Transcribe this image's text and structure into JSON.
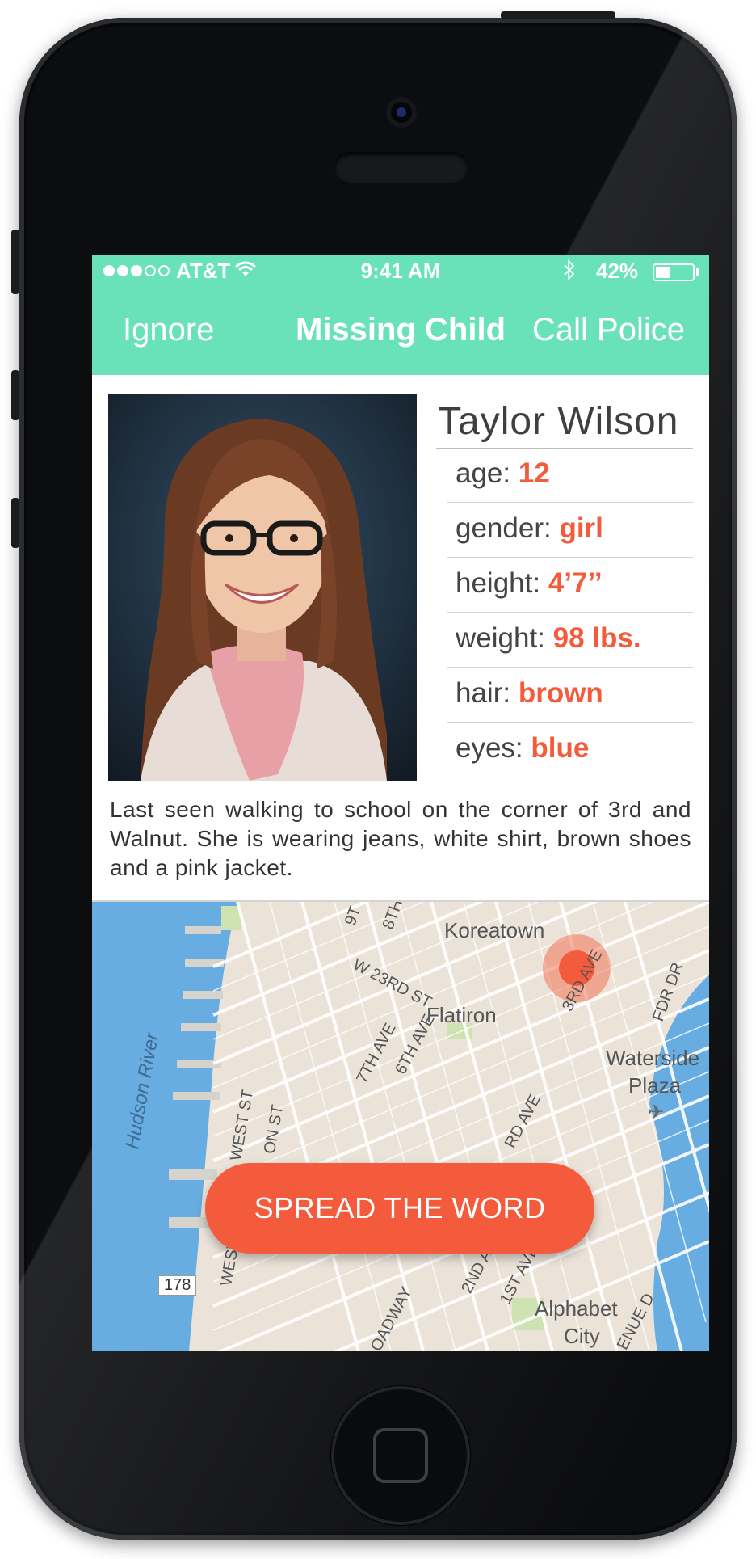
{
  "status_bar": {
    "carrier": "AT&T",
    "time": "9:41 AM",
    "battery_percent": "42%",
    "battery_level": 0.42,
    "signal_bars_filled": 3,
    "signal_bars_total": 5
  },
  "nav": {
    "left_label": "Ignore",
    "title": "Missing Child",
    "right_label": "Call Police"
  },
  "profile": {
    "name": "Taylor  Wilson",
    "stats": [
      {
        "label": "age:",
        "value": "12"
      },
      {
        "label": "gender:",
        "value": "girl"
      },
      {
        "label": "height:",
        "value": "4’7’’"
      },
      {
        "label": "weight:",
        "value": "98 lbs."
      },
      {
        "label": "hair:",
        "value": "brown"
      },
      {
        "label": "eyes:",
        "value": "blue"
      }
    ],
    "description": "Last seen walking to school on the corner of 3rd and Walnut. She is wearing jeans, white shirt, brown shoes and a pink jacket."
  },
  "map": {
    "labels": {
      "koreatown": "Koreatown",
      "w23rd": "W 23RD ST",
      "seventh": "7TH AVE",
      "sixth": "6TH AVE",
      "flatiron": "Flatiron",
      "third": "3RD AVE",
      "fdr": "FDR DR",
      "waterside1": "Waterside",
      "waterside2": "Plaza",
      "hudson": "Hudson River",
      "weststreet": "WEST ST",
      "westst2": "WEST ST",
      "onst": "ON ST",
      "rdave": "RD AVE",
      "second": "2ND A",
      "first": "1ST AVE",
      "broadway": "OADWAY",
      "alphabet1": "Alphabet",
      "alphabet2": "City",
      "enue": "ENUE D",
      "route": "178",
      "ninth": "9T",
      "eighth": "8TH"
    }
  },
  "cta": {
    "label": "SPREAD THE WORD"
  },
  "colors": {
    "accent_green": "#6ae2b9",
    "accent_orange": "#f45a3c",
    "stat_value": "#f35b3b"
  }
}
